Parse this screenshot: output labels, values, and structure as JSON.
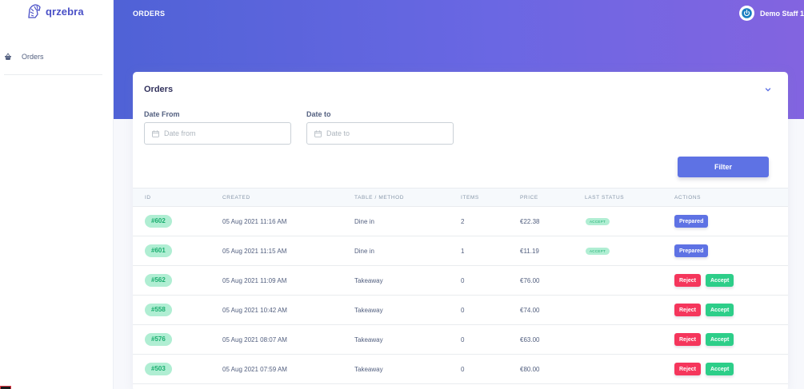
{
  "app": {
    "logo_text": "qrzebra"
  },
  "sidebar": {
    "items": [
      {
        "label": "Orders",
        "icon": "shopping-basket-icon"
      }
    ]
  },
  "header": {
    "title": "ORDERS",
    "user_name": "Demo Staff 1",
    "user_icon": "power-icon"
  },
  "card": {
    "title": "Orders",
    "collapse_icon": "chevron-down-icon"
  },
  "filters": {
    "date_from_label": "Date From",
    "date_from_placeholder": "Date from",
    "date_to_label": "Date to",
    "date_to_placeholder": "Date to",
    "filter_button": "Filter"
  },
  "table": {
    "columns": [
      "ID",
      "CREATED",
      "TABLE / METHOD",
      "ITEMS",
      "PRICE",
      "LAST STATUS",
      "ACTIONS"
    ],
    "rows": [
      {
        "id": "#602",
        "created": "05 Aug 2021 11:16 AM",
        "method": "Dine in",
        "items": "2",
        "price": "€22.38",
        "status": "ACCEPT",
        "actions": [
          "Prepared"
        ]
      },
      {
        "id": "#601",
        "created": "05 Aug 2021 11:15 AM",
        "method": "Dine in",
        "items": "1",
        "price": "€11.19",
        "status": "ACCEPT",
        "actions": [
          "Prepared"
        ]
      },
      {
        "id": "#562",
        "created": "05 Aug 2021 11:09 AM",
        "method": "Takeaway",
        "items": "0",
        "price": "€76.00",
        "status": "",
        "actions": [
          "Reject",
          "Accept"
        ]
      },
      {
        "id": "#558",
        "created": "05 Aug 2021 10:42 AM",
        "method": "Takeaway",
        "items": "0",
        "price": "€74.00",
        "status": "",
        "actions": [
          "Reject",
          "Accept"
        ]
      },
      {
        "id": "#576",
        "created": "05 Aug 2021 08:07 AM",
        "method": "Takeaway",
        "items": "0",
        "price": "€63.00",
        "status": "",
        "actions": [
          "Reject",
          "Accept"
        ]
      },
      {
        "id": "#503",
        "created": "05 Aug 2021 07:59 AM",
        "method": "Takeaway",
        "items": "0",
        "price": "€80.00",
        "status": "",
        "actions": [
          "Reject",
          "Accept"
        ]
      }
    ]
  },
  "colors": {
    "primary": "#5e72e4",
    "danger": "#f5365c",
    "success": "#2dce89",
    "badge_bg": "#b0eed3",
    "badge_text": "#1aae6f",
    "header_gradient_start": "#4f62d6",
    "header_gradient_end": "#8364e0"
  }
}
